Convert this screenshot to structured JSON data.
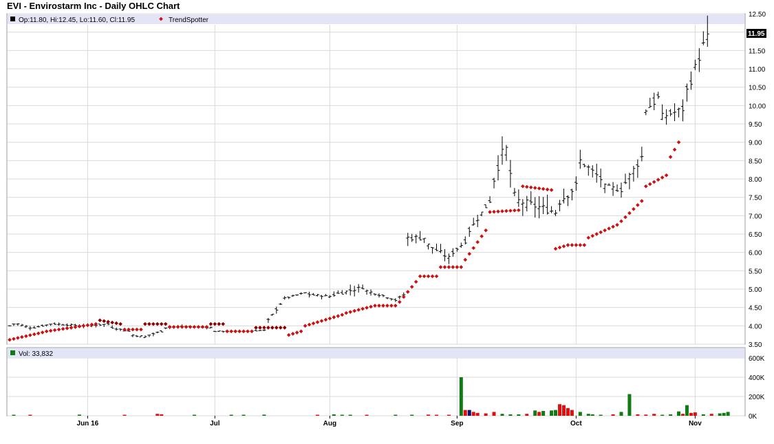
{
  "title": "EVI - Envirostarm Inc - Daily OHLC Chart",
  "colors": {
    "panel_border": "#9a9aa8",
    "legend_bar": "#e3e5f7",
    "grid": "#d9d9d9",
    "price": "#000000",
    "trend_red": "#cc1111",
    "trend_dark": "#8b0000",
    "vol_green": "#127a12",
    "vol_red": "#e01010",
    "vol_navy": "#10106b"
  },
  "chart_data": [
    {
      "type": "ohlc",
      "legend": {
        "ohlc_label": "Op:11.80, Hi:12.45, Lo:11.60, Cl:11.95",
        "trend_label": "TrendSpotter"
      },
      "last_close_label": "11.95",
      "y_ticks": [
        "12.50",
        "12.00",
        "11.50",
        "11.00",
        "10.50",
        "10.00",
        "9.50",
        "9.00",
        "8.50",
        "8.00",
        "7.50",
        "7.00",
        "6.50",
        "6.00",
        "5.50",
        "5.00",
        "4.50",
        "4.00",
        "3.50"
      ],
      "ylim": [
        3.5,
        12.5
      ],
      "x_labels": [
        "Jun 16",
        "Jul",
        "Aug",
        "Sep",
        "Oct",
        "Nov"
      ],
      "x_label_bars": [
        19,
        50,
        78,
        109,
        138,
        167
      ],
      "bar_count": 180,
      "segments": [
        {
          "bars": 2,
          "from": 4.0,
          "to": 4.05,
          "amp": 0.06
        },
        {
          "bars": 4,
          "from": 4.05,
          "to": 3.95,
          "amp": 0.06
        },
        {
          "bars": 5,
          "from": 3.95,
          "to": 4.05,
          "amp": 0.05
        },
        {
          "bars": 8,
          "from": 4.05,
          "to": 4.0,
          "amp": 0.06
        },
        {
          "bars": 6,
          "from": 4.0,
          "to": 4.05,
          "amp": 0.07
        },
        {
          "bars": 5,
          "from": 3.95,
          "to": 3.85,
          "amp": 0.06
        },
        {
          "bars": 4,
          "from": 3.75,
          "to": 3.7,
          "amp": 0.08
        },
        {
          "bars": 4,
          "from": 3.75,
          "to": 3.85,
          "amp": 0.07
        },
        {
          "bars": 5,
          "from": 3.95,
          "to": 3.98,
          "amp": 0.05
        },
        {
          "bars": 7,
          "from": 3.98,
          "to": 3.95,
          "amp": 0.04
        },
        {
          "bars": 7,
          "from": 3.85,
          "to": 3.85,
          "amp": 0.04
        },
        {
          "bars": 6,
          "from": 3.85,
          "to": 3.88,
          "amp": 0.04
        },
        {
          "bars": 4,
          "from": 4.15,
          "to": 4.6,
          "amp": 0.1
        },
        {
          "bars": 6,
          "from": 4.75,
          "to": 4.9,
          "amp": 0.06
        },
        {
          "bars": 6,
          "from": 4.85,
          "to": 4.8,
          "amp": 0.08
        },
        {
          "bars": 8,
          "from": 4.85,
          "to": 5.05,
          "amp": 0.15
        },
        {
          "bars": 7,
          "from": 4.95,
          "to": 4.75,
          "amp": 0.1
        },
        {
          "bars": 3,
          "from": 4.7,
          "to": 4.85,
          "amp": 0.08
        },
        {
          "bars": 5,
          "from": 6.4,
          "to": 6.4,
          "amp": 0.25
        },
        {
          "bars": 6,
          "from": 6.2,
          "to": 5.85,
          "amp": 0.2
        },
        {
          "bars": 4,
          "from": 6.0,
          "to": 6.3,
          "amp": 0.15
        },
        {
          "bars": 6,
          "from": 6.6,
          "to": 7.4,
          "amp": 0.2
        },
        {
          "bars": 3,
          "from": 8.0,
          "to": 8.7,
          "amp": 0.4
        },
        {
          "bars": 3,
          "from": 8.8,
          "to": 7.5,
          "amp": 0.5
        },
        {
          "bars": 10,
          "from": 7.4,
          "to": 7.1,
          "amp": 0.35
        },
        {
          "bars": 5,
          "from": 7.4,
          "to": 7.8,
          "amp": 0.4
        },
        {
          "bars": 6,
          "from": 8.5,
          "to": 8.0,
          "amp": 0.3
        },
        {
          "bars": 5,
          "from": 7.8,
          "to": 7.7,
          "amp": 0.2
        },
        {
          "bars": 5,
          "from": 7.9,
          "to": 8.6,
          "amp": 0.35
        },
        {
          "bars": 4,
          "from": 9.9,
          "to": 10.2,
          "amp": 0.4
        },
        {
          "bars": 6,
          "from": 9.7,
          "to": 9.9,
          "amp": 0.3
        },
        {
          "bars": 6,
          "from": 10.4,
          "to": 11.95,
          "amp": 0.45
        }
      ],
      "trendspotter": [
        {
          "bars": 9,
          "from": 3.62,
          "to": 3.82,
          "color": "red"
        },
        {
          "bars": 13,
          "from": 3.85,
          "to": 4.05,
          "color": "red"
        },
        {
          "bars": 6,
          "from": 4.15,
          "to": 4.05,
          "color": "dark"
        },
        {
          "bars": 5,
          "from": 3.9,
          "to": 3.9,
          "color": "red"
        },
        {
          "bars": 6,
          "from": 4.05,
          "to": 4.05,
          "color": "dark"
        },
        {
          "bars": 10,
          "from": 3.97,
          "to": 3.97,
          "color": "red"
        },
        {
          "bars": 4,
          "from": 4.05,
          "to": 4.05,
          "color": "dark"
        },
        {
          "bars": 7,
          "from": 3.85,
          "to": 3.85,
          "color": "red"
        },
        {
          "bars": 8,
          "from": 3.95,
          "to": 3.95,
          "color": "dark"
        },
        {
          "bars": 4,
          "from": 3.75,
          "to": 3.85,
          "color": "red"
        },
        {
          "bars": 10,
          "from": 4.0,
          "to": 4.3,
          "color": "red"
        },
        {
          "bars": 8,
          "from": 4.35,
          "to": 4.55,
          "color": "red"
        },
        {
          "bars": 5,
          "from": 4.55,
          "to": 4.55,
          "color": "red"
        },
        {
          "bars": 5,
          "from": 4.65,
          "to": 5.2,
          "color": "red"
        },
        {
          "bars": 5,
          "from": 5.35,
          "to": 5.35,
          "color": "red"
        },
        {
          "bars": 6,
          "from": 5.6,
          "to": 5.6,
          "color": "red"
        },
        {
          "bars": 6,
          "from": 5.8,
          "to": 6.6,
          "color": "red"
        },
        {
          "bars": 8,
          "from": 7.1,
          "to": 7.15,
          "color": "red"
        },
        {
          "bars": 8,
          "from": 7.8,
          "to": 7.7,
          "color": "red"
        },
        {
          "bars": 4,
          "from": 6.1,
          "to": 6.2,
          "color": "red"
        },
        {
          "bars": 4,
          "from": 6.2,
          "to": 6.2,
          "color": "red"
        },
        {
          "bars": 8,
          "from": 6.4,
          "to": 6.75,
          "color": "red"
        },
        {
          "bars": 6,
          "from": 6.85,
          "to": 7.4,
          "color": "red"
        },
        {
          "bars": 6,
          "from": 7.8,
          "to": 8.1,
          "color": "red"
        },
        {
          "bars": 3,
          "from": 8.6,
          "to": 9.0,
          "color": "red"
        }
      ]
    },
    {
      "type": "bar",
      "legend": {
        "volume_label": "Vol: 33,832"
      },
      "y_ticks": [
        "600K",
        "400K",
        "200K",
        "0K"
      ],
      "ylim": [
        0,
        600000
      ],
      "volume_markers": [
        {
          "bar": 1,
          "value": 10000,
          "color": "green"
        },
        {
          "bar": 5,
          "value": 8000,
          "color": "red"
        },
        {
          "bar": 17,
          "value": 12000,
          "color": "green"
        },
        {
          "bar": 28,
          "value": 10000,
          "color": "red"
        },
        {
          "bar": 36,
          "value": 20000,
          "color": "red"
        },
        {
          "bar": 37,
          "value": 15000,
          "color": "red"
        },
        {
          "bar": 45,
          "value": 8000,
          "color": "green"
        },
        {
          "bar": 54,
          "value": 10000,
          "color": "green"
        },
        {
          "bar": 57,
          "value": 10000,
          "color": "green"
        },
        {
          "bar": 62,
          "value": 12000,
          "color": "green"
        },
        {
          "bar": 75,
          "value": 8000,
          "color": "red"
        },
        {
          "bar": 79,
          "value": 15000,
          "color": "green"
        },
        {
          "bar": 81,
          "value": 10000,
          "color": "green"
        },
        {
          "bar": 83,
          "value": 10000,
          "color": "green"
        },
        {
          "bar": 87,
          "value": 8000,
          "color": "red"
        },
        {
          "bar": 94,
          "value": 8000,
          "color": "green"
        },
        {
          "bar": 98,
          "value": 10000,
          "color": "green"
        },
        {
          "bar": 102,
          "value": 12000,
          "color": "red"
        },
        {
          "bar": 104,
          "value": 10000,
          "color": "red"
        },
        {
          "bar": 107,
          "value": 10000,
          "color": "red"
        },
        {
          "bar": 110,
          "value": 400000,
          "color": "green"
        },
        {
          "bar": 111,
          "value": 60000,
          "color": "red"
        },
        {
          "bar": 112,
          "value": 60000,
          "color": "navy"
        },
        {
          "bar": 113,
          "value": 40000,
          "color": "red"
        },
        {
          "bar": 114,
          "value": 30000,
          "color": "red"
        },
        {
          "bar": 116,
          "value": 25000,
          "color": "red"
        },
        {
          "bar": 118,
          "value": 40000,
          "color": "red"
        },
        {
          "bar": 120,
          "value": 20000,
          "color": "green"
        },
        {
          "bar": 122,
          "value": 15000,
          "color": "green"
        },
        {
          "bar": 124,
          "value": 15000,
          "color": "green"
        },
        {
          "bar": 126,
          "value": 20000,
          "color": "red"
        },
        {
          "bar": 128,
          "value": 55000,
          "color": "green"
        },
        {
          "bar": 129,
          "value": 40000,
          "color": "red"
        },
        {
          "bar": 130,
          "value": 50000,
          "color": "green"
        },
        {
          "bar": 132,
          "value": 55000,
          "color": "green"
        },
        {
          "bar": 133,
          "value": 60000,
          "color": "green"
        },
        {
          "bar": 134,
          "value": 120000,
          "color": "red"
        },
        {
          "bar": 135,
          "value": 110000,
          "color": "red"
        },
        {
          "bar": 136,
          "value": 80000,
          "color": "red"
        },
        {
          "bar": 137,
          "value": 60000,
          "color": "red"
        },
        {
          "bar": 139,
          "value": 40000,
          "color": "green"
        },
        {
          "bar": 141,
          "value": 20000,
          "color": "green"
        },
        {
          "bar": 142,
          "value": 15000,
          "color": "green"
        },
        {
          "bar": 144,
          "value": 10000,
          "color": "green"
        },
        {
          "bar": 147,
          "value": 15000,
          "color": "red"
        },
        {
          "bar": 149,
          "value": 40000,
          "color": "green"
        },
        {
          "bar": 151,
          "value": 225000,
          "color": "green"
        },
        {
          "bar": 153,
          "value": 15000,
          "color": "red"
        },
        {
          "bar": 155,
          "value": 12000,
          "color": "red"
        },
        {
          "bar": 157,
          "value": 20000,
          "color": "red"
        },
        {
          "bar": 159,
          "value": 10000,
          "color": "green"
        },
        {
          "bar": 161,
          "value": 15000,
          "color": "green"
        },
        {
          "bar": 163,
          "value": 45000,
          "color": "green"
        },
        {
          "bar": 164,
          "value": 20000,
          "color": "red"
        },
        {
          "bar": 165,
          "value": 110000,
          "color": "green"
        },
        {
          "bar": 166,
          "value": 30000,
          "color": "red"
        },
        {
          "bar": 167,
          "value": 35000,
          "color": "red"
        },
        {
          "bar": 169,
          "value": 15000,
          "color": "green"
        },
        {
          "bar": 171,
          "value": 20000,
          "color": "red"
        },
        {
          "bar": 173,
          "value": 25000,
          "color": "green"
        },
        {
          "bar": 174,
          "value": 30000,
          "color": "green"
        },
        {
          "bar": 175,
          "value": 40000,
          "color": "green"
        }
      ]
    }
  ]
}
